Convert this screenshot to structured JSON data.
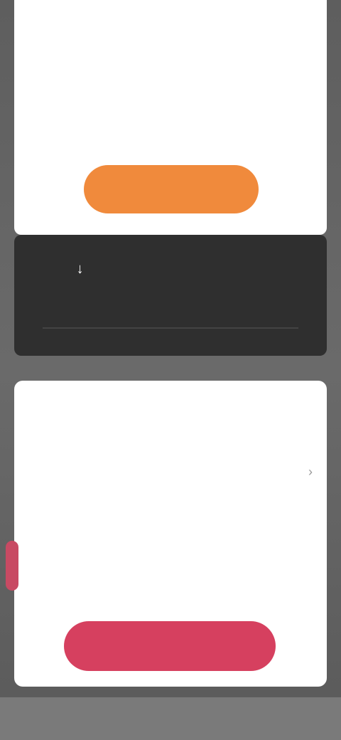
{
  "top_bar": {
    "back_label": "",
    "menu_icon": "more-icon"
  },
  "top_card": {
    "orange_button_label": ""
  },
  "dark_strip": {
    "items": [
      {
        "icon": "↓",
        "label": ""
      },
      {
        "icon": "",
        "label": ""
      },
      {
        "icon": "",
        "label": ""
      }
    ]
  },
  "bottom_card": {
    "small_label": "",
    "title": "",
    "meta_left_1": "",
    "meta_left_2": "",
    "sub_text": "",
    "price": "",
    "price_note": "",
    "chevron": "›"
  },
  "pink_button": {
    "label": ""
  },
  "colors": {
    "orange": "#f08a3c",
    "pink": "#d6405f",
    "dark": "#2f2f2f",
    "white": "#ffffff"
  }
}
